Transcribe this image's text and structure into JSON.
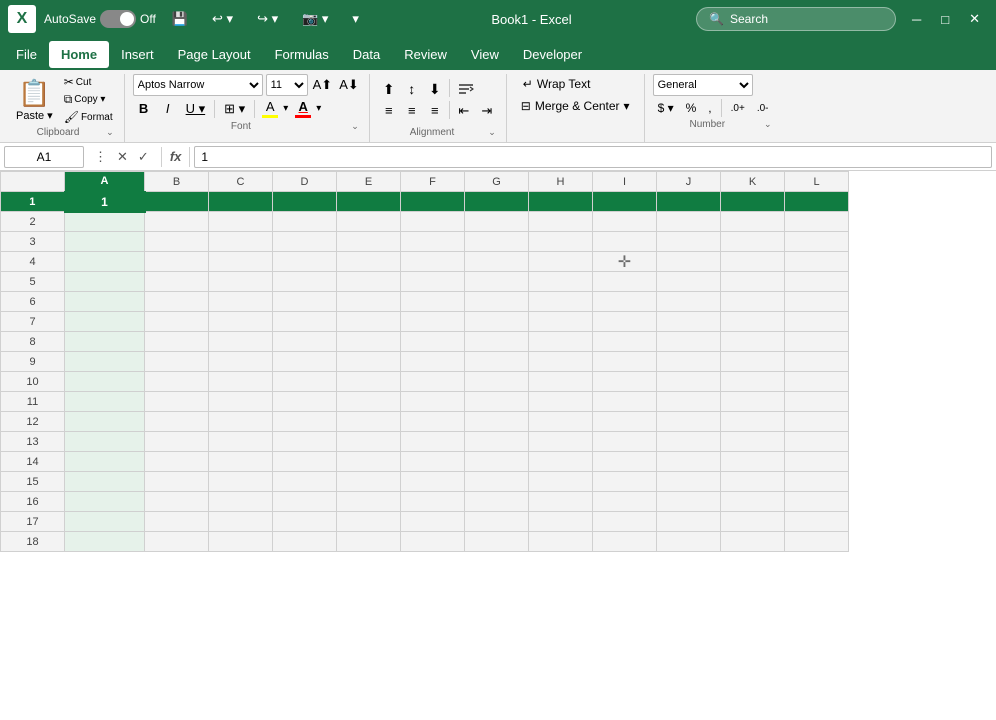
{
  "titleBar": {
    "logo": "X",
    "autosave_label": "AutoSave",
    "toggle_state": "Off",
    "save_icon": "💾",
    "undo_icon": "↩",
    "redo_icon": "↪",
    "camera_icon": "📷",
    "dropdown_icon": "▾",
    "title": "Book1 - Excel",
    "search_placeholder": "Search",
    "search_icon": "🔍"
  },
  "toolbar": {
    "items": [
      "💾",
      "↩",
      "↪",
      "📷",
      "▾"
    ]
  },
  "menuBar": {
    "items": [
      "File",
      "Home",
      "Insert",
      "Page Layout",
      "Formulas",
      "Data",
      "Review",
      "View",
      "Developer"
    ],
    "active": "Home"
  },
  "ribbon": {
    "clipboard": {
      "label": "Clipboard",
      "paste_label": "Paste",
      "paste_icon": "📋",
      "cut_label": "✂",
      "copy_label": "⧉",
      "format_label": "🖌"
    },
    "font": {
      "label": "Font",
      "font_name": "Aptos Narrow",
      "font_size": "11",
      "increase_size": "A↑",
      "decrease_size": "A↓",
      "bold": "B",
      "italic": "I",
      "underline": "U",
      "borders": "⊞",
      "fill_color": "A",
      "fill_color_bar": "#ffff00",
      "font_color": "A",
      "font_color_bar": "#ff0000"
    },
    "alignment": {
      "label": "Alignment",
      "top_align": "⊤",
      "mid_align": "≡",
      "bot_align": "⊥",
      "left_align": "≡",
      "center_align": "≡",
      "right_align": "≡",
      "decrease_indent": "⇤",
      "increase_indent": "⇥",
      "wrap_text": "Wrap Text",
      "merge_center": "Merge & Center",
      "expand_icon": "⌄"
    },
    "wrapMerge": {
      "label": "Alignment",
      "wrap_icon": "↵",
      "wrap_label": "Wrap Text",
      "merge_icon": "⊟",
      "merge_label": "Merge & Center",
      "merge_arrow": "▾"
    },
    "number": {
      "label": "Number",
      "format": "General",
      "currency_label": "$",
      "percent_label": "%",
      "comma_label": ",",
      "increase_dec": ".0→",
      "decrease_dec": "←.0"
    }
  },
  "formulaBar": {
    "cell_ref": "A1",
    "cancel_icon": "✕",
    "confirm_icon": "✓",
    "function_icon": "fx",
    "formula_value": "1"
  },
  "spreadsheet": {
    "active_cell": "A1",
    "active_col": "A",
    "active_row": 1,
    "columns": [
      "",
      "A",
      "B",
      "C",
      "D",
      "E",
      "F",
      "G",
      "H",
      "I",
      "J",
      "K",
      "L"
    ],
    "rows": 18,
    "cell_a1_value": "1",
    "crosshair_row": 4,
    "crosshair_col": "I"
  }
}
